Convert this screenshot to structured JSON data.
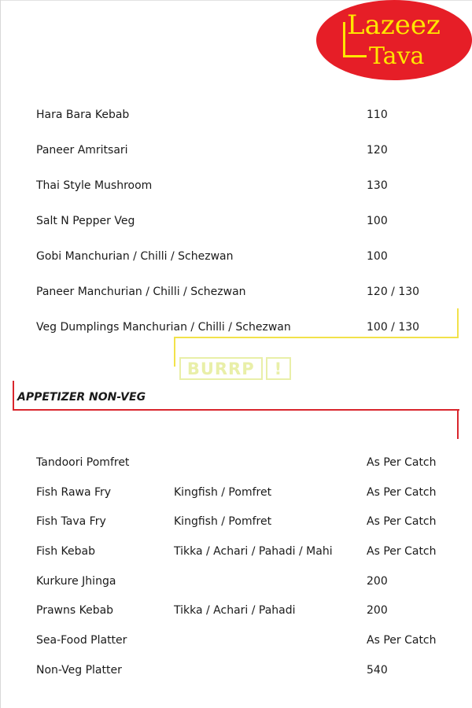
{
  "brand": {
    "line1": "Lazeez",
    "line2": "Tava"
  },
  "watermark": {
    "word": "BURRP",
    "mark": "!"
  },
  "veg_items": [
    {
      "name": "Hara Bara Kebab",
      "price": "110"
    },
    {
      "name": "Paneer Amritsari",
      "price": "120"
    },
    {
      "name": "Thai Style Mushroom",
      "price": "130"
    },
    {
      "name": "Salt N Pepper Veg",
      "price": "100"
    },
    {
      "name": "Gobi Manchurian / Chilli / Schezwan",
      "price": "100"
    },
    {
      "name": "Paneer Manchurian / Chilli / Schezwan",
      "price": "120 / 130"
    },
    {
      "name": "Veg Dumplings Manchurian / Chilli / Schezwan",
      "price": "100 / 130"
    }
  ],
  "section_title": "APPETIZER NON-VEG",
  "nonveg_items": [
    {
      "name": "Tandoori Pomfret",
      "variant": "",
      "price": "As Per Catch"
    },
    {
      "name": "Fish Rawa Fry",
      "variant": "Kingfish / Pomfret",
      "price": "As Per Catch"
    },
    {
      "name": "Fish Tava Fry",
      "variant": "Kingfish / Pomfret",
      "price": "As Per Catch"
    },
    {
      "name": "Fish Kebab",
      "variant": "Tikka / Achari / Pahadi / Mahi",
      "price": "As Per Catch"
    },
    {
      "name": "Kurkure Jhinga",
      "variant": "",
      "price": "200"
    },
    {
      "name": "Prawns Kebab",
      "variant": "Tikka / Achari / Pahadi",
      "price": "200"
    },
    {
      "name": "Sea-Food Platter",
      "variant": "",
      "price": "As Per Catch"
    },
    {
      "name": "Non-Veg Platter",
      "variant": "",
      "price": "540"
    }
  ]
}
